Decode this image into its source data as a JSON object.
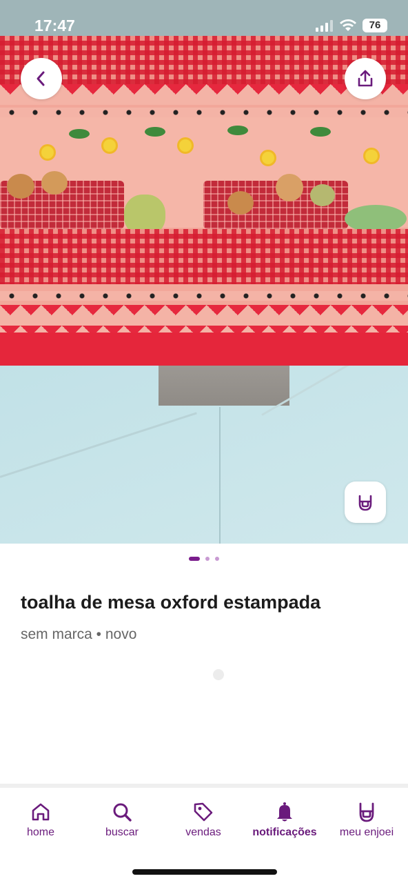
{
  "status_bar": {
    "time": "17:47",
    "battery": "76"
  },
  "product": {
    "title": "toalha de mesa oxford estampada",
    "meta": "sem marca • novo",
    "image_count": 3,
    "current_image": 1
  },
  "photo_buttons": {
    "back_icon": "chevron-left-icon",
    "share_icon": "share-icon",
    "rock_icon": "rock-hand-icon"
  },
  "nav": {
    "items": [
      {
        "label": "home",
        "icon": "house-icon"
      },
      {
        "label": "buscar",
        "icon": "search-icon"
      },
      {
        "label": "vendas",
        "icon": "tag-icon"
      },
      {
        "label": "notificações",
        "icon": "bell-icon",
        "active": true
      },
      {
        "label": "meu enjoei",
        "icon": "rock-hand-icon"
      }
    ]
  },
  "colors": {
    "brand_purple": "#6a1b7c",
    "pager_active": "#7a1d8c",
    "pager_inactive": "#c89ad2"
  }
}
